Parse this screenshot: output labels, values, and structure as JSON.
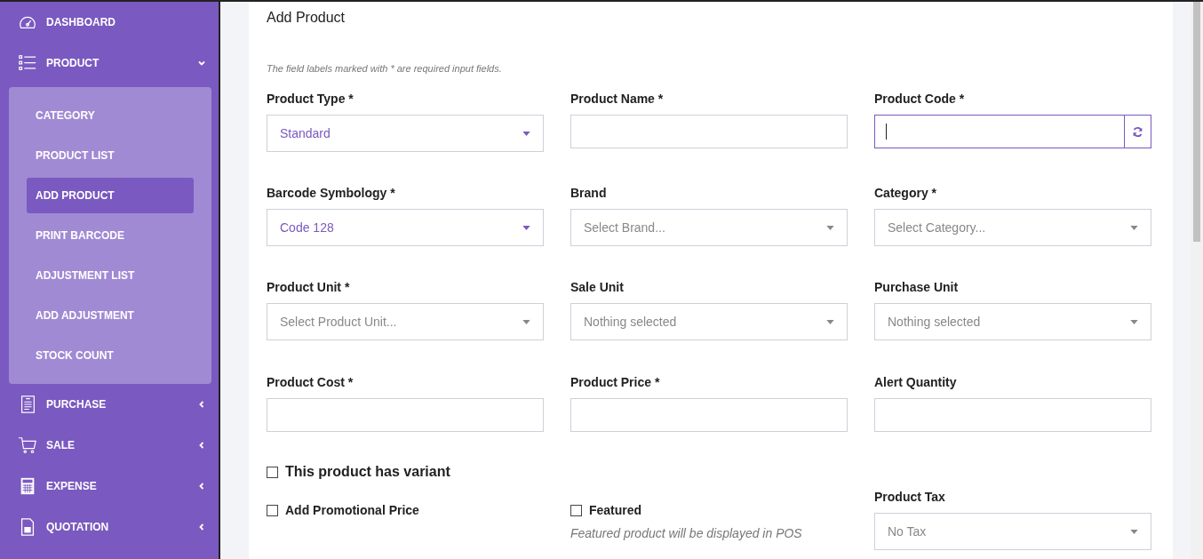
{
  "sidebar": {
    "items": [
      {
        "label": "DASHBOARD"
      },
      {
        "label": "PRODUCT",
        "expanded": true,
        "children": [
          {
            "label": "CATEGORY",
            "selected": false
          },
          {
            "label": "PRODUCT LIST",
            "selected": false
          },
          {
            "label": "ADD PRODUCT",
            "selected": true
          },
          {
            "label": "PRINT BARCODE",
            "selected": false
          },
          {
            "label": "ADJUSTMENT LIST",
            "selected": false
          },
          {
            "label": "ADD ADJUSTMENT",
            "selected": false
          },
          {
            "label": "STOCK COUNT",
            "selected": false
          }
        ]
      },
      {
        "label": "PURCHASE",
        "expanded": false
      },
      {
        "label": "SALE",
        "expanded": false
      },
      {
        "label": "EXPENSE",
        "expanded": false
      },
      {
        "label": "QUOTATION",
        "expanded": false
      }
    ]
  },
  "form": {
    "title": "Add Product",
    "note": "The field labels marked with * are required input fields.",
    "fields": [
      {
        "label": "Product Type *",
        "kind": "select",
        "value": "Standard"
      },
      {
        "label": "Product Name *",
        "kind": "text"
      },
      {
        "label": "Product Code *",
        "kind": "code",
        "focused": true
      },
      {
        "label": "Barcode Symbology *",
        "kind": "select",
        "value": "Code 128"
      },
      {
        "label": "Brand",
        "kind": "select",
        "placeholder": "Select Brand..."
      },
      {
        "label": "Category *",
        "kind": "select",
        "placeholder": "Select Category..."
      },
      {
        "label": "Product Unit *",
        "kind": "select",
        "placeholder": "Select Product Unit..."
      },
      {
        "label": "Sale Unit",
        "kind": "select",
        "placeholder": "Nothing selected"
      },
      {
        "label": "Purchase Unit",
        "kind": "select",
        "placeholder": "Nothing selected"
      },
      {
        "label": "Product Cost *",
        "kind": "text"
      },
      {
        "label": "Product Price *",
        "kind": "text"
      },
      {
        "label": "Alert Quantity",
        "kind": "text"
      }
    ],
    "variant": {
      "label": "This product has variant",
      "checked": false
    },
    "promo": {
      "label": "Add Promotional Price",
      "checked": false
    },
    "featured": {
      "label": "Featured",
      "checked": false,
      "hint": "Featured product will be displayed in POS"
    },
    "tax": {
      "label": "Product Tax",
      "placeholder": "No Tax"
    }
  }
}
